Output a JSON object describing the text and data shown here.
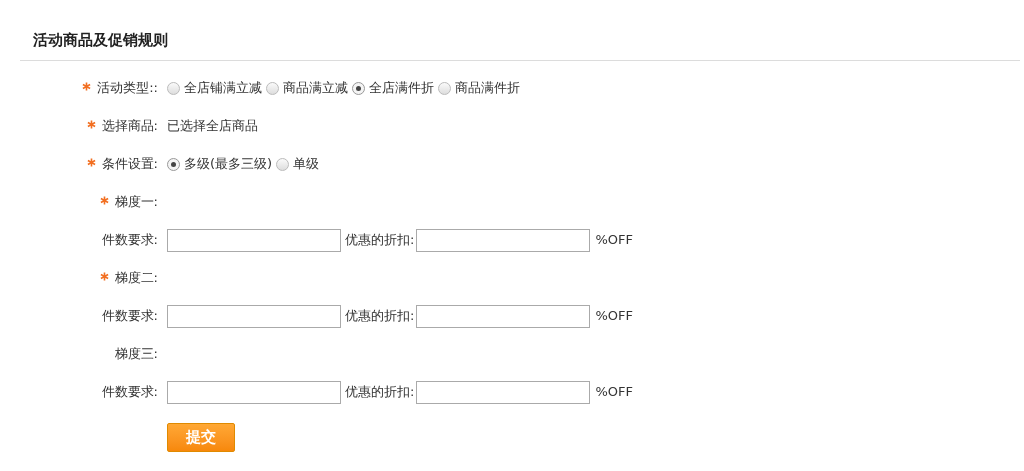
{
  "section_title": "活动商品及促销规则",
  "rows": [
    {
      "kind": "radio",
      "label": "活动类型::",
      "required": true,
      "options": [
        {
          "label": "全店铺满立减",
          "selected": false
        },
        {
          "label": "商品满立减",
          "selected": false
        },
        {
          "label": "全店满件折",
          "selected": true
        },
        {
          "label": "商品满件折",
          "selected": false
        }
      ]
    },
    {
      "kind": "text",
      "label": "选择商品:",
      "required": true,
      "value": "已选择全店商品"
    },
    {
      "kind": "radio",
      "label": "条件设置:",
      "required": true,
      "options": [
        {
          "label": "多级(最多三级)",
          "selected": true
        },
        {
          "label": "单级",
          "selected": false
        }
      ]
    },
    {
      "kind": "heading",
      "label": "梯度一:",
      "required": true
    },
    {
      "kind": "tier",
      "label": "件数要求:",
      "discount_label": "优惠的折扣:",
      "unit": "%OFF"
    },
    {
      "kind": "heading",
      "label": "梯度二:",
      "required": true
    },
    {
      "kind": "tier",
      "label": "件数要求:",
      "discount_label": "优惠的折扣:",
      "unit": "%OFF"
    },
    {
      "kind": "heading",
      "label": "梯度三:",
      "required": false
    },
    {
      "kind": "tier",
      "label": "件数要求:",
      "discount_label": "优惠的折扣:",
      "unit": "%OFF"
    }
  ],
  "submit_button": "提交"
}
